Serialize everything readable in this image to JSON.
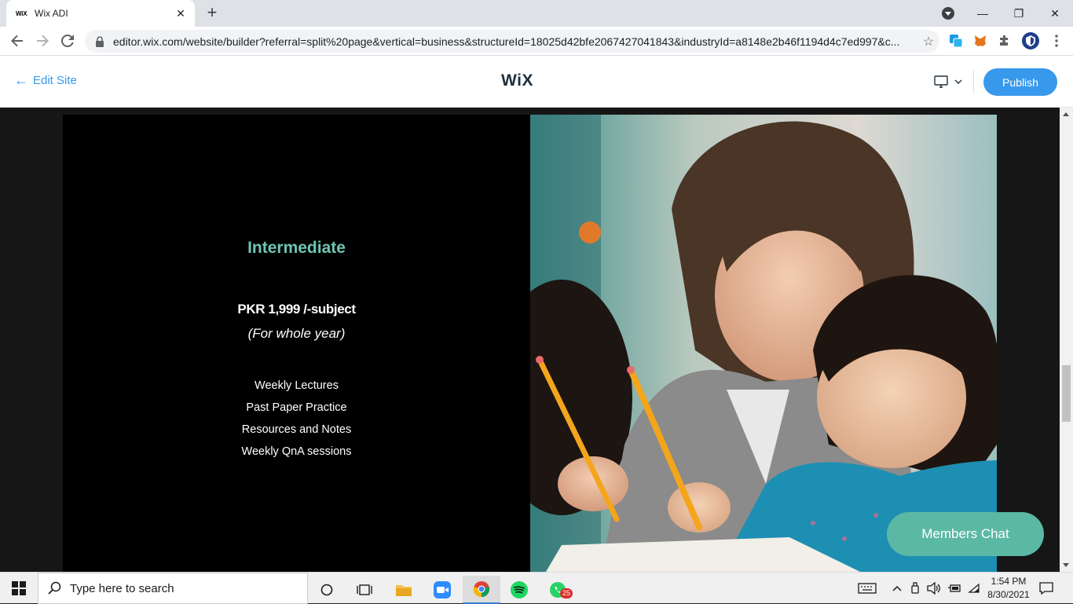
{
  "browser": {
    "tab_title": "Wix ADI",
    "tab_favicon": "WiX",
    "url": "editor.wix.com/website/builder?referral=split%20page&vertical=business&structureId=18025d42bfe2067427041843&industryId=a8148e2b46f1194d4c7ed997&c..."
  },
  "wix_header": {
    "back_label": "Edit Site",
    "logo": "WiX",
    "publish_label": "Publish"
  },
  "plan": {
    "title": "Intermediate",
    "price": "PKR 1,999 /-subject",
    "period": "(For whole year)",
    "features": [
      "Weekly Lectures",
      "Past Paper Practice",
      "Resources and Notes",
      "Weekly QnA sessions"
    ]
  },
  "chat_button": "Members Chat",
  "taskbar": {
    "search_placeholder": "Type here to search",
    "whatsapp_badge": "25",
    "time": "1:54 PM",
    "date": "8/30/2021"
  },
  "colors": {
    "accent_blue": "#3899ec",
    "plan_title": "#6ec5b3",
    "chat_button": "#5bb8a4"
  }
}
